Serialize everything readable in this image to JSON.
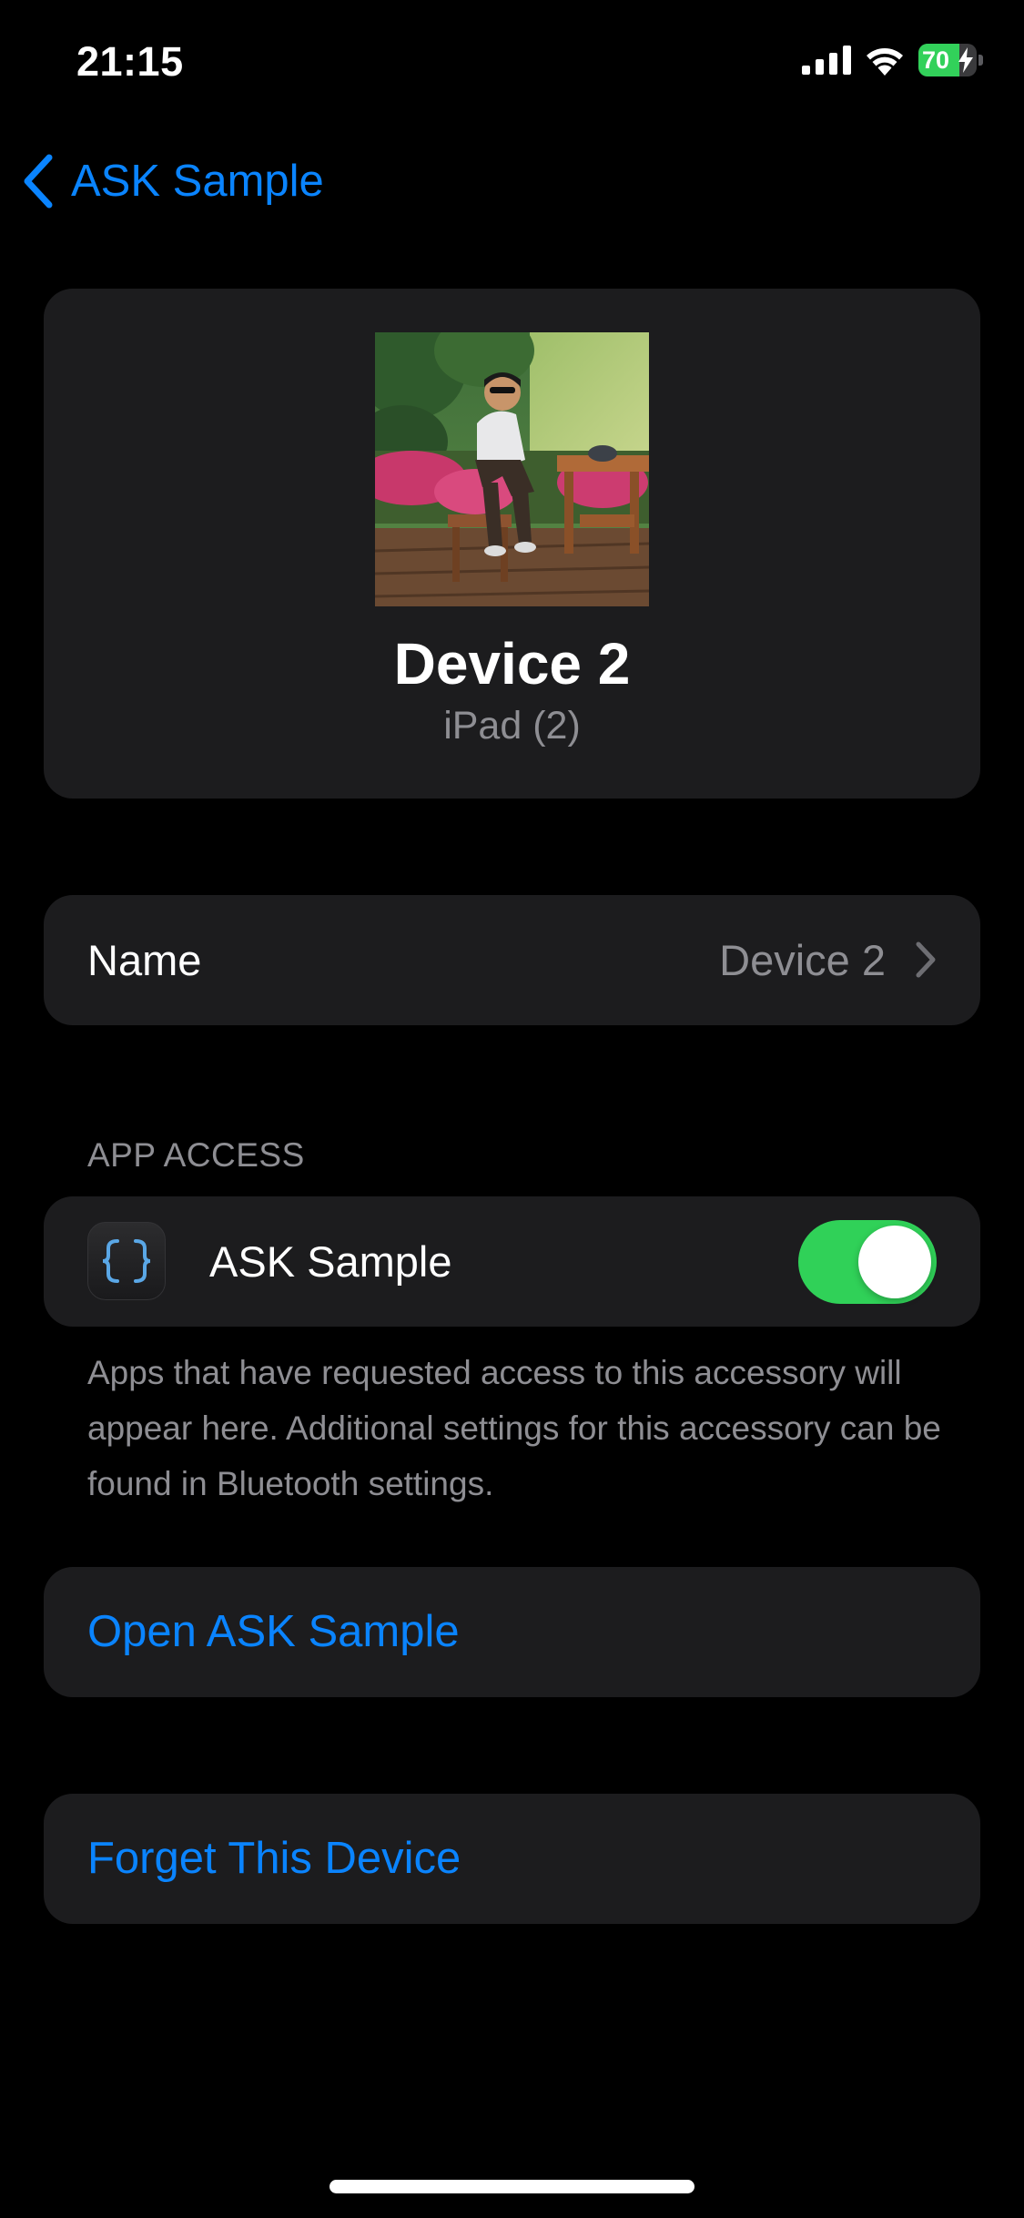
{
  "status_bar": {
    "time": "21:15",
    "battery": "70",
    "battery_level": 0.7,
    "battery_charging": true,
    "icons": [
      "signal-icon",
      "wifi-icon",
      "battery-icon"
    ]
  },
  "nav": {
    "back_label": "ASK Sample",
    "back_icon": "chevron-left-icon"
  },
  "device": {
    "name": "Device 2",
    "model": "iPad (2)",
    "photo": "device-photo"
  },
  "name_row": {
    "label": "Name",
    "value": "Device 2"
  },
  "app_access": {
    "header": "APP ACCESS",
    "app_name": "ASK Sample",
    "app_icon": "curly-braces-icon",
    "enabled": true,
    "footer": "Apps that have requested access to this accessory will appear here. Additional settings for this accessory can be found in Bluetooth settings."
  },
  "actions": {
    "open_label": "Open ASK Sample",
    "forget_label": "Forget This Device"
  },
  "colors": {
    "accent": "#0a84ff",
    "toggle_on": "#30d158",
    "background": "#000000",
    "card": "#1c1c1e",
    "secondary_text": "#8e8e93"
  }
}
